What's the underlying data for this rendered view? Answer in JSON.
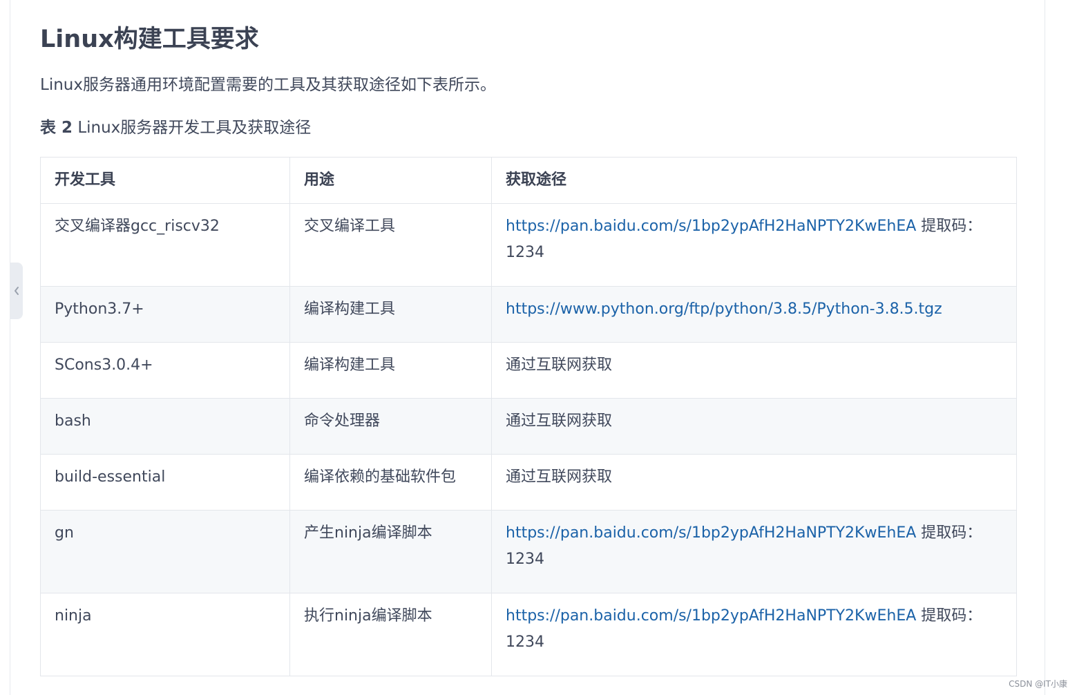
{
  "title": "Linux构建工具要求",
  "intro": "Linux服务器通用环境配置需要的工具及其获取途径如下表所示。",
  "caption": {
    "label": "表 2",
    "text": " Linux服务器开发工具及获取途径"
  },
  "table": {
    "headers": [
      "开发工具",
      "用途",
      "获取途径"
    ],
    "rows": [
      {
        "tool": "交叉编译器gcc_riscv32",
        "purpose": "交叉编译工具",
        "link": "https://pan.baidu.com/s/1bp2ypAfH2HaNPTY2KwEhEA",
        "suffix": " 提取码：1234"
      },
      {
        "tool": "Python3.7+",
        "purpose": "编译构建工具",
        "link": "https://www.python.org/ftp/python/3.8.5/Python-3.8.5.tgz",
        "suffix": ""
      },
      {
        "tool": "SCons3.0.4+",
        "purpose": "编译构建工具",
        "plain": "通过互联网获取"
      },
      {
        "tool": "bash",
        "purpose": "命令处理器",
        "plain": "通过互联网获取"
      },
      {
        "tool": "build-essential",
        "purpose": "编译依赖的基础软件包",
        "plain": "通过互联网获取"
      },
      {
        "tool": "gn",
        "purpose": "产生ninja编译脚本",
        "link": "https://pan.baidu.com/s/1bp2ypAfH2HaNPTY2KwEhEA",
        "suffix": " 提取码：1234"
      },
      {
        "tool": "ninja",
        "purpose": "执行ninja编译脚本",
        "link": "https://pan.baidu.com/s/1bp2ypAfH2HaNPTY2KwEhEA",
        "suffix": " 提取码：1234"
      }
    ]
  },
  "watermark": "CSDN @IT小康",
  "icons": {
    "collapse": "chevron-left-icon"
  },
  "colors": {
    "link": "#1b62a8",
    "text": "#40485b",
    "alt_row": "#f6f8fa"
  }
}
